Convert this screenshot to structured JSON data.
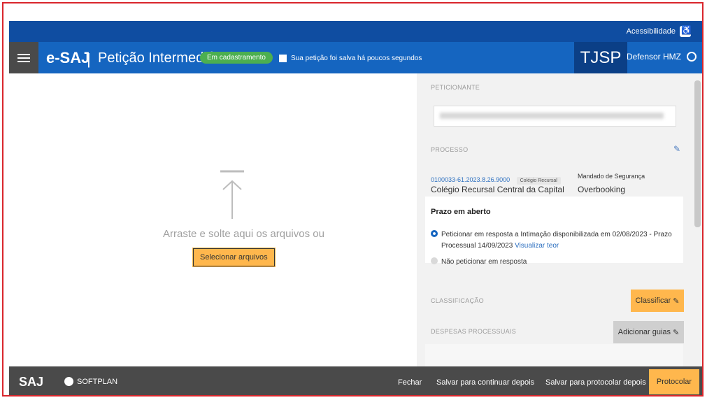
{
  "header": {
    "accessibility_label": "Acessibilidade",
    "brand": "e-SAJ",
    "separator": "|",
    "title": "Petição Intermediária",
    "status_badge": "Em cadastramento",
    "save_info": "Sua petição foi salva há poucos segundos",
    "court_logo": "TJSP",
    "user_name": "Defensor HMZ"
  },
  "dropzone": {
    "text": "Arraste e solte aqui os arquivos ou",
    "select_button": "Selecionar arquivos"
  },
  "sidebar": {
    "peticionante": {
      "label": "PETICIONANTE"
    },
    "processo": {
      "label": "PROCESSO",
      "number": "0100033-61.2023.8.26.9000",
      "chip": "Colégio Recursal",
      "court": "Colégio Recursal Central da Capital",
      "type_label": "Mandado de Segurança",
      "type_value": "Overbooking",
      "prazo_title": "Prazo em aberto",
      "option_1_text": "Peticionar em resposta a Intimação disponibilizada em 02/08/2023 - Prazo Processual 14/09/2023",
      "option_1_link": "Visualizar teor",
      "option_2_text": "Não peticionar em resposta"
    },
    "classificacao": {
      "label": "CLASSIFICAÇÃO",
      "button": "Classificar"
    },
    "despesas": {
      "label": "DESPESAS PROCESSUAIS",
      "button": "Adicionar guias"
    }
  },
  "footer": {
    "saj": "SAJ",
    "softplan": "SOFTPLAN",
    "close": "Fechar",
    "save_continue": "Salvar para continuar depois",
    "save_protocol": "Salvar para protocolar depois",
    "protocol": "Protocolar"
  },
  "colors": {
    "primary": "#1565c0",
    "accent": "#ffb74d",
    "badge": "#4caf50"
  }
}
